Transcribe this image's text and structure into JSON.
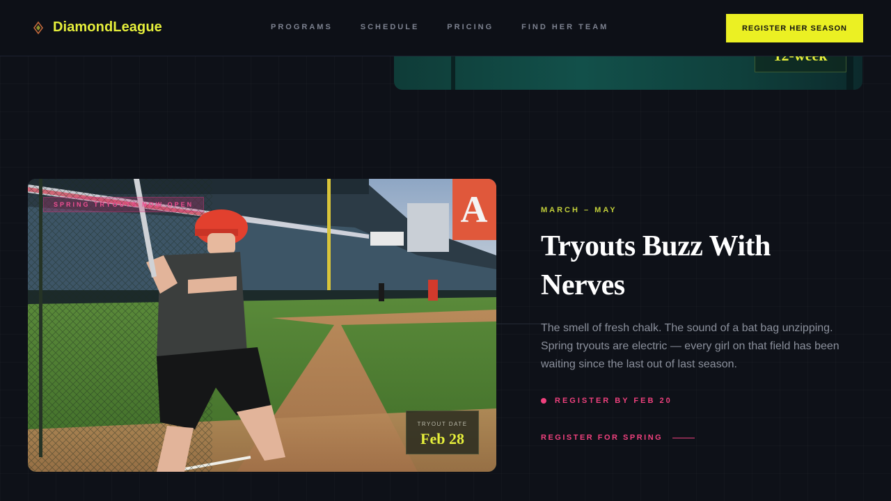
{
  "brand": {
    "name": "DiamondLeague",
    "accent": "#e6ef3b",
    "icon": "diamond-logo-icon"
  },
  "nav": [
    {
      "label": "PROGRAMS"
    },
    {
      "label": "SCHEDULE"
    },
    {
      "label": "PRICING"
    },
    {
      "label": "FIND HER TEAM"
    }
  ],
  "header_cta": {
    "label": "REGISTER HER SEASON",
    "color": "#ebf023"
  },
  "previous_card": {
    "badge_text": "12-week"
  },
  "feature": {
    "photo_banner": "SPRING TRYOUTS NOW OPEN",
    "date_badge": {
      "label": "TRYOUT DATE",
      "value": "Feb 28"
    },
    "eyebrow": "MARCH – MAY",
    "title": "Tryouts Buzz With Nerves",
    "body": "The smell of fresh chalk. The sound of a bat bag unzipping. Spring tryouts are electric — every girl on that field has been waiting since the last out of last season.",
    "deadline": "REGISTER BY FEB 20",
    "cta": "REGISTER FOR SPRING",
    "pink": "#f0417e"
  }
}
